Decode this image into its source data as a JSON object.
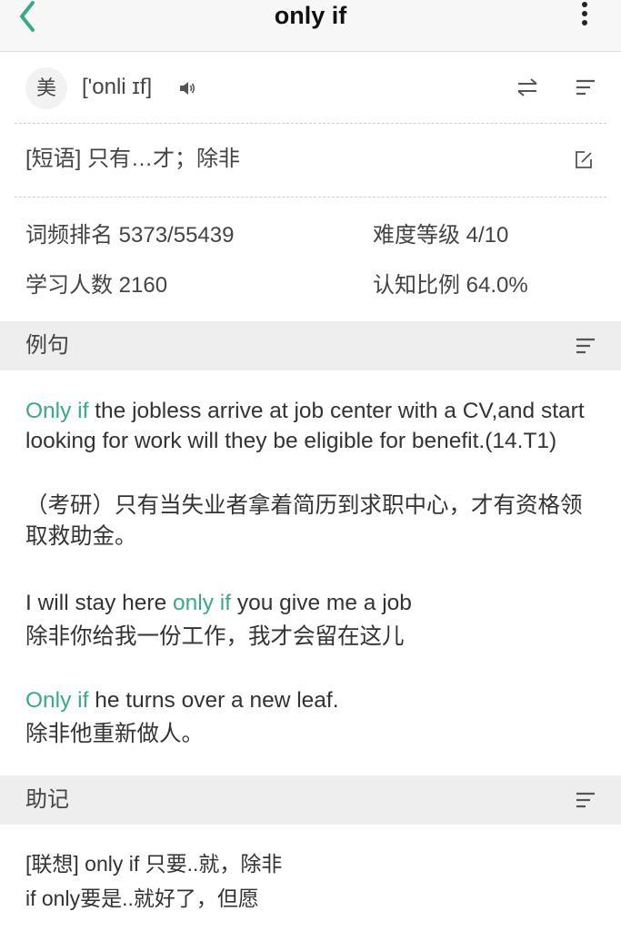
{
  "header": {
    "title": "only if",
    "back_icon": "chevron-left-icon",
    "more_icon": "more-vertical-icon",
    "accent_color": "#3aa88a"
  },
  "pronunciation": {
    "region": "美",
    "phonetic": "['onli ɪf]",
    "speaker_icon": "speaker-icon",
    "switch_icon": "swap-arrows-icon",
    "sort_icon": "sort-lines-icon"
  },
  "definition": {
    "text": "[短语] 只有…才；除非",
    "edit_icon": "edit-icon"
  },
  "stats": {
    "freq_rank": "词频排名 5373/55439",
    "difficulty": "难度等级 4/10",
    "learners": "学习人数 2160",
    "cognition": "认知比例 64.0%"
  },
  "examples": {
    "section_title": "例句",
    "items": [
      {
        "en_pre": "",
        "en_hl": "Only if",
        "en_post": " the jobless arrive at job center with a CV,and start looking for work will they be eligible for benefit.(14.T1)",
        "zh": "（考研）只有当失业者拿着简历到求职中心，才有资格领取救助金。"
      },
      {
        "en_pre": "I will stay here ",
        "en_hl": "only if",
        "en_post": " you give me a job",
        "zh": "除非你给我一份工作，我才会留在这儿"
      },
      {
        "en_pre": "",
        "en_hl": "Only if",
        "en_post": " he turns over a new leaf.",
        "zh": "除非他重新做人。"
      }
    ]
  },
  "mnemonic": {
    "section_title": "助记",
    "lines": [
      "[联想] only if 只要..就，除非",
      "if only要是..就好了，但愿"
    ]
  }
}
